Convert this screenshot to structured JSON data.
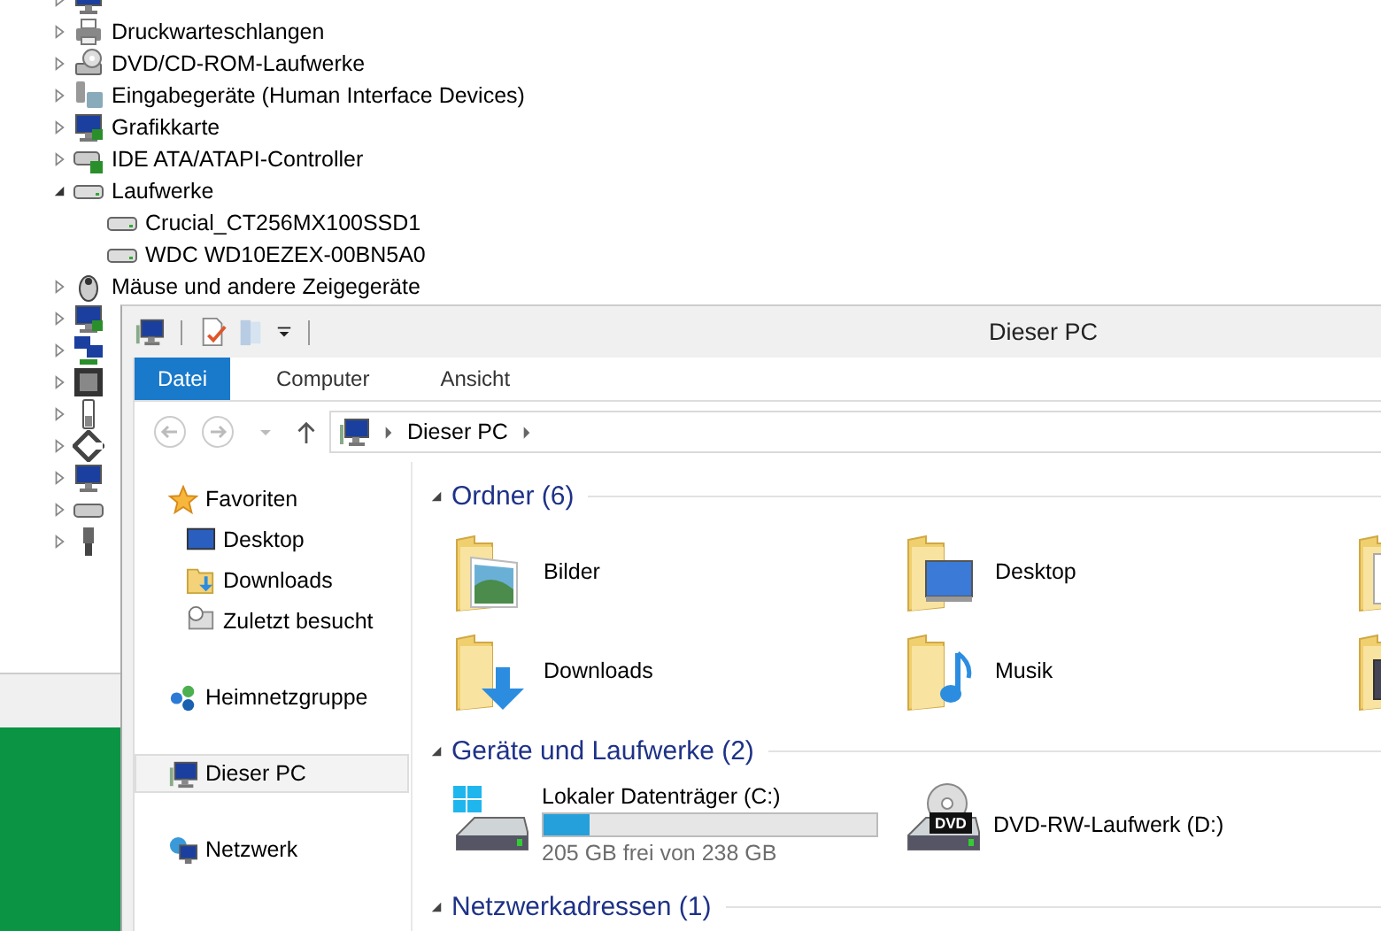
{
  "device_tree": [
    {
      "kind": "computer",
      "expanded": false
    },
    {
      "label": "Druckwarteschlangen",
      "kind": "printer",
      "expanded": false
    },
    {
      "label": "DVD/CD-ROM-Laufwerke",
      "kind": "dvd",
      "expanded": false
    },
    {
      "label": "Eingabegeräte (Human Interface Devices)",
      "kind": "hid",
      "expanded": false
    },
    {
      "label": "Grafikkarte",
      "kind": "monitor",
      "expanded": false
    },
    {
      "label": "IDE ATA/ATAPI-Controller",
      "kind": "controller",
      "expanded": false
    },
    {
      "label": "Laufwerke",
      "kind": "drive",
      "expanded": true,
      "children": [
        {
          "label": "Crucial_CT256MX100SSD1",
          "kind": "drive"
        },
        {
          "label": "WDC WD10EZEX-00BN5A0",
          "kind": "drive"
        }
      ]
    },
    {
      "label": "Mäuse und andere Zeigegeräte",
      "kind": "mouse",
      "expanded": false
    },
    {
      "kind": "monitor",
      "expanded": false
    },
    {
      "kind": "network",
      "expanded": false
    },
    {
      "kind": "chip",
      "expanded": false
    },
    {
      "kind": "battery",
      "expanded": false
    },
    {
      "kind": "plug",
      "expanded": false
    },
    {
      "kind": "computer",
      "expanded": false
    },
    {
      "kind": "keyboard",
      "expanded": false
    },
    {
      "kind": "usb",
      "expanded": false
    }
  ],
  "explorer": {
    "title": "Dieser PC",
    "ribbon_tabs": [
      {
        "label": "Datei",
        "selected": true
      },
      {
        "label": "Computer",
        "selected": false
      },
      {
        "label": "Ansicht",
        "selected": false
      }
    ],
    "address": [
      "Dieser PC"
    ],
    "nav_pane": [
      {
        "label": "Favoriten",
        "kind": "star",
        "selected": false,
        "children": [
          {
            "label": "Desktop",
            "kind": "desktop",
            "selected": false
          },
          {
            "label": "Downloads",
            "kind": "downloads",
            "selected": false
          },
          {
            "label": "Zuletzt besucht",
            "kind": "recent",
            "selected": false
          }
        ]
      },
      {
        "label": "Heimnetzgruppe",
        "kind": "homegroup",
        "selected": false
      },
      {
        "label": "Dieser PC",
        "kind": "pc",
        "selected": true
      },
      {
        "label": "Netzwerk",
        "kind": "network",
        "selected": false
      }
    ],
    "groups": [
      {
        "title": "Ordner (6)",
        "kind": "folders",
        "items": [
          {
            "name": "Bilder",
            "kind": "pictures"
          },
          {
            "name": "Desktop",
            "kind": "desktop"
          },
          {
            "kind": "documents"
          },
          {
            "name": "Downloads",
            "kind": "downloads"
          },
          {
            "name": "Musik",
            "kind": "music"
          },
          {
            "kind": "videos"
          }
        ]
      },
      {
        "title": "Geräte und Laufwerke (2)",
        "kind": "drives",
        "items": [
          {
            "name": "Lokaler Datenträger (C:)",
            "kind": "hdd",
            "level": 0.14,
            "free": "205 GB frei von 238 GB"
          },
          {
            "name": "DVD-RW-Laufwerk (D:)",
            "kind": "dvd",
            "badge": "DVD"
          }
        ]
      },
      {
        "title": "Netzwerkadressen (1)",
        "kind": "network"
      }
    ]
  }
}
